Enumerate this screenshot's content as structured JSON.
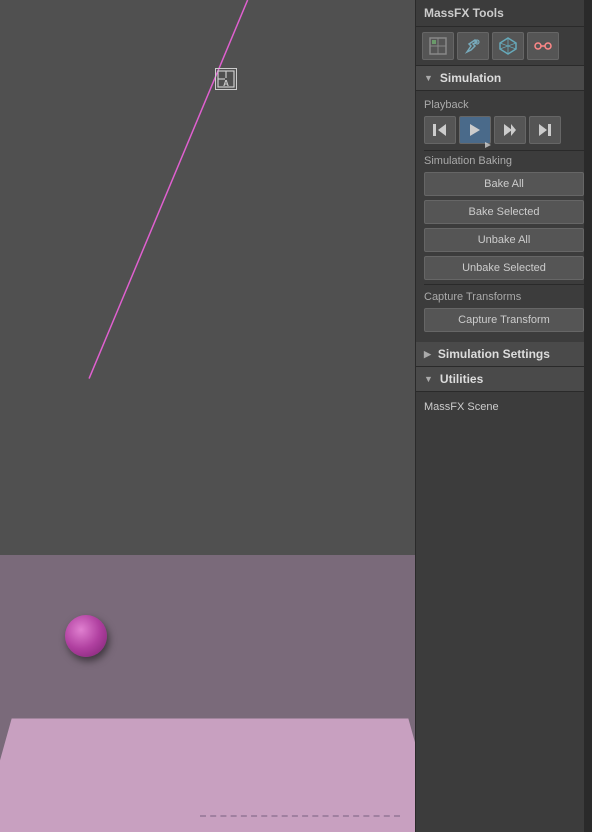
{
  "panel": {
    "title": "MassFX Tools",
    "toolbar": {
      "buttons": [
        {
          "label": "⬚",
          "name": "world-icon",
          "title": "World"
        },
        {
          "label": "🔧",
          "name": "tools-icon",
          "title": "Tools"
        },
        {
          "label": "⬡",
          "name": "rigid-icon",
          "title": "Rigid Body"
        },
        {
          "label": "✦",
          "name": "constraint-icon",
          "title": "Constraint"
        }
      ]
    }
  },
  "simulation_section": {
    "label": "Simulation",
    "playback": {
      "label": "Playback",
      "buttons": [
        {
          "label": "⏮",
          "name": "rewind-btn",
          "title": "Go to Start"
        },
        {
          "label": "▶",
          "name": "play-btn",
          "title": "Play",
          "active": true
        },
        {
          "label": "▶▶",
          "name": "step-forward-btn",
          "title": "Step Forward"
        },
        {
          "label": "⏭",
          "name": "fast-forward-btn",
          "title": "Go to End"
        }
      ]
    },
    "baking": {
      "label": "Simulation Baking",
      "bake_all": "Bake All",
      "bake_selected": "Bake Selected",
      "unbake_all": "Unbake All",
      "unbake_selected": "Unbake Selected"
    },
    "capture": {
      "label": "Capture Transforms",
      "button": "Capture Transform"
    }
  },
  "simulation_settings": {
    "label": "Simulation Settings"
  },
  "utilities": {
    "label": "Utilities",
    "massfx_scene": "MassFX Scene"
  },
  "gizmo": {
    "symbol": "⊹"
  },
  "viewport": {
    "floor_dashes": "- - - - - - - - - - - -"
  }
}
